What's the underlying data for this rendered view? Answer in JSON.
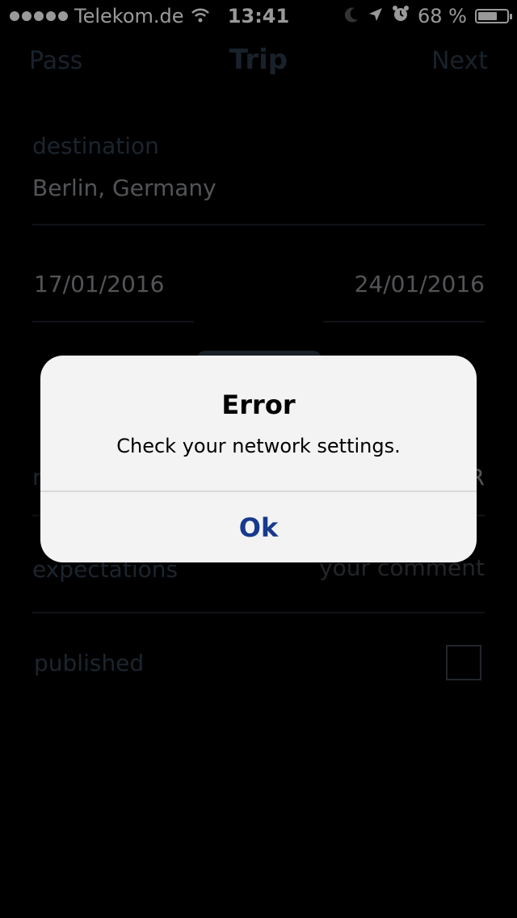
{
  "status_bar": {
    "carrier": "Telekom.de",
    "time": "13:41",
    "battery": "68 %",
    "battery_level": 0.68,
    "icons": [
      "signal-dots-icon",
      "wifi-icon",
      "moon-icon",
      "location-arrow-icon",
      "alarm-icon",
      "battery-icon"
    ]
  },
  "nav": {
    "left": "Pass",
    "title": "Trip",
    "right": "Next"
  },
  "form": {
    "destination_label": "destination",
    "destination_value": "Berlin, Germany",
    "start_date": "17/01/2016",
    "end_date": "24/01/2016",
    "partial_left": "r",
    "partial_right": "R",
    "expectations_label": "expectations",
    "expectations_placeholder": "your comment",
    "published_label": "published"
  },
  "alert": {
    "title": "Error",
    "message": "Check your network settings.",
    "button": "Ok"
  },
  "colors": {
    "background": "#000000",
    "label": "#2f3e4d",
    "alert_button": "#173a8d"
  }
}
